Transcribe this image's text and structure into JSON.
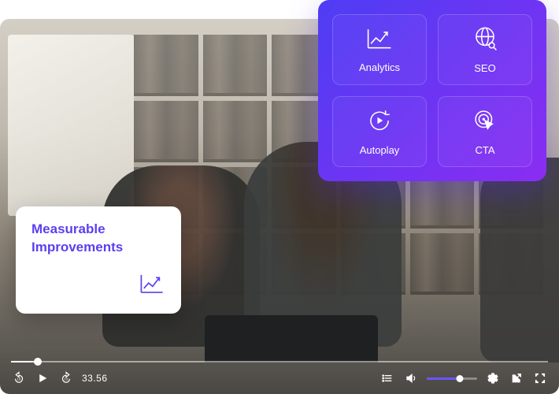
{
  "card": {
    "title": "Measurable Improvements",
    "icon": "trend-up-icon"
  },
  "features": [
    {
      "icon": "analytics-icon",
      "label": "Analytics"
    },
    {
      "icon": "seo-icon",
      "label": "SEO"
    },
    {
      "icon": "autoplay-icon",
      "label": "Autoplay"
    },
    {
      "icon": "cta-icon",
      "label": "CTA"
    }
  ],
  "player": {
    "timecode": "33.56",
    "progress_percent": 5,
    "volume_percent": 65,
    "accent_color": "#6b55ff"
  }
}
